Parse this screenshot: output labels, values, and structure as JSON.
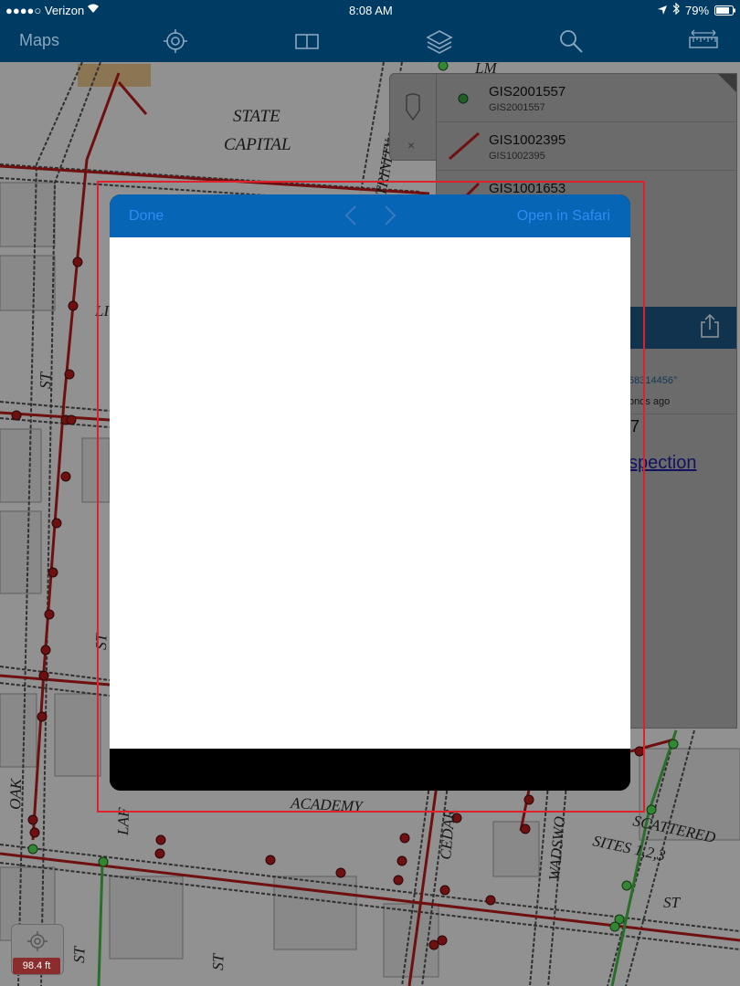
{
  "status_bar": {
    "carrier": "●●●●○ Verizon",
    "time": "8:08 AM",
    "battery": "79%"
  },
  "toolbar": {
    "maps_label": "Maps",
    "icons": [
      "locate-icon",
      "book-icon",
      "layers-icon",
      "search-icon",
      "measure-icon"
    ]
  },
  "map_labels": {
    "state_line1": "STATE",
    "state_line2": "CAPITAL",
    "trinity": "TRINITY",
    "st1": "ST",
    "st2": "ST",
    "oak": "OAK",
    "laf": "LAF",
    "academy": "ACADEMY",
    "cedar": "CEDAR",
    "wadsworth": "WADSWO",
    "scattered": "SCATTERED",
    "sites": "SITES 1,2,3",
    "st3": "ST",
    "st4": "ST",
    "st5": "ST",
    "lm": "LM",
    "li": "LI"
  },
  "panel": {
    "features": [
      {
        "title": "GIS2001557",
        "subtitle": "GIS2001557",
        "kind": "point"
      },
      {
        "title": "GIS1002395",
        "subtitle": "GIS1002395",
        "kind": "line"
      },
      {
        "title": "GIS1001653",
        "subtitle": "",
        "kind": "line"
      }
    ],
    "frag_coord": "68314456°",
    "frag_time": "onds ago",
    "frag_num": "7",
    "frag_link": "spection"
  },
  "modal": {
    "done_label": "Done",
    "open_label": "Open in Safari"
  },
  "scale_label": "98.4 ft",
  "colors": {
    "toolbar": "#003b63",
    "modal_bar": "#0665b4",
    "link_blue": "#2f8cf4",
    "highlight": "#e0212b"
  }
}
